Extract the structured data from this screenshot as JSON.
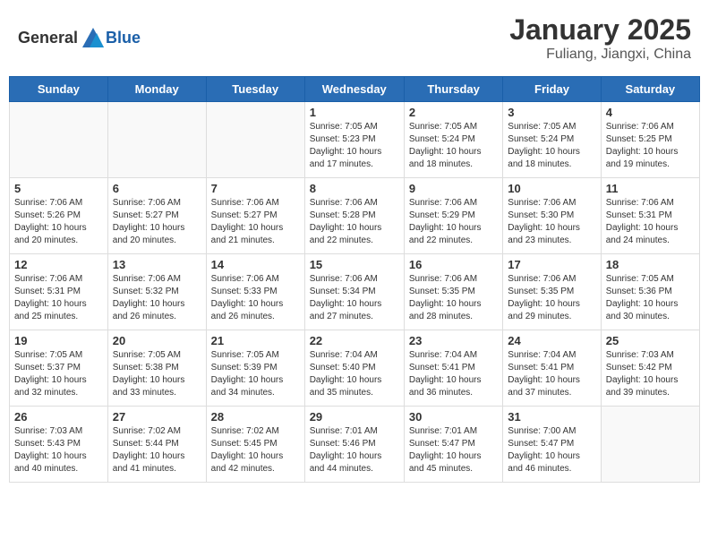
{
  "header": {
    "logo_general": "General",
    "logo_blue": "Blue",
    "month": "January 2025",
    "location": "Fuliang, Jiangxi, China"
  },
  "weekdays": [
    "Sunday",
    "Monday",
    "Tuesday",
    "Wednesday",
    "Thursday",
    "Friday",
    "Saturday"
  ],
  "weeks": [
    [
      {
        "day": "",
        "info": ""
      },
      {
        "day": "",
        "info": ""
      },
      {
        "day": "",
        "info": ""
      },
      {
        "day": "1",
        "info": "Sunrise: 7:05 AM\nSunset: 5:23 PM\nDaylight: 10 hours\nand 17 minutes."
      },
      {
        "day": "2",
        "info": "Sunrise: 7:05 AM\nSunset: 5:24 PM\nDaylight: 10 hours\nand 18 minutes."
      },
      {
        "day": "3",
        "info": "Sunrise: 7:05 AM\nSunset: 5:24 PM\nDaylight: 10 hours\nand 18 minutes."
      },
      {
        "day": "4",
        "info": "Sunrise: 7:06 AM\nSunset: 5:25 PM\nDaylight: 10 hours\nand 19 minutes."
      }
    ],
    [
      {
        "day": "5",
        "info": "Sunrise: 7:06 AM\nSunset: 5:26 PM\nDaylight: 10 hours\nand 20 minutes."
      },
      {
        "day": "6",
        "info": "Sunrise: 7:06 AM\nSunset: 5:27 PM\nDaylight: 10 hours\nand 20 minutes."
      },
      {
        "day": "7",
        "info": "Sunrise: 7:06 AM\nSunset: 5:27 PM\nDaylight: 10 hours\nand 21 minutes."
      },
      {
        "day": "8",
        "info": "Sunrise: 7:06 AM\nSunset: 5:28 PM\nDaylight: 10 hours\nand 22 minutes."
      },
      {
        "day": "9",
        "info": "Sunrise: 7:06 AM\nSunset: 5:29 PM\nDaylight: 10 hours\nand 22 minutes."
      },
      {
        "day": "10",
        "info": "Sunrise: 7:06 AM\nSunset: 5:30 PM\nDaylight: 10 hours\nand 23 minutes."
      },
      {
        "day": "11",
        "info": "Sunrise: 7:06 AM\nSunset: 5:31 PM\nDaylight: 10 hours\nand 24 minutes."
      }
    ],
    [
      {
        "day": "12",
        "info": "Sunrise: 7:06 AM\nSunset: 5:31 PM\nDaylight: 10 hours\nand 25 minutes."
      },
      {
        "day": "13",
        "info": "Sunrise: 7:06 AM\nSunset: 5:32 PM\nDaylight: 10 hours\nand 26 minutes."
      },
      {
        "day": "14",
        "info": "Sunrise: 7:06 AM\nSunset: 5:33 PM\nDaylight: 10 hours\nand 26 minutes."
      },
      {
        "day": "15",
        "info": "Sunrise: 7:06 AM\nSunset: 5:34 PM\nDaylight: 10 hours\nand 27 minutes."
      },
      {
        "day": "16",
        "info": "Sunrise: 7:06 AM\nSunset: 5:35 PM\nDaylight: 10 hours\nand 28 minutes."
      },
      {
        "day": "17",
        "info": "Sunrise: 7:06 AM\nSunset: 5:35 PM\nDaylight: 10 hours\nand 29 minutes."
      },
      {
        "day": "18",
        "info": "Sunrise: 7:05 AM\nSunset: 5:36 PM\nDaylight: 10 hours\nand 30 minutes."
      }
    ],
    [
      {
        "day": "19",
        "info": "Sunrise: 7:05 AM\nSunset: 5:37 PM\nDaylight: 10 hours\nand 32 minutes."
      },
      {
        "day": "20",
        "info": "Sunrise: 7:05 AM\nSunset: 5:38 PM\nDaylight: 10 hours\nand 33 minutes."
      },
      {
        "day": "21",
        "info": "Sunrise: 7:05 AM\nSunset: 5:39 PM\nDaylight: 10 hours\nand 34 minutes."
      },
      {
        "day": "22",
        "info": "Sunrise: 7:04 AM\nSunset: 5:40 PM\nDaylight: 10 hours\nand 35 minutes."
      },
      {
        "day": "23",
        "info": "Sunrise: 7:04 AM\nSunset: 5:41 PM\nDaylight: 10 hours\nand 36 minutes."
      },
      {
        "day": "24",
        "info": "Sunrise: 7:04 AM\nSunset: 5:41 PM\nDaylight: 10 hours\nand 37 minutes."
      },
      {
        "day": "25",
        "info": "Sunrise: 7:03 AM\nSunset: 5:42 PM\nDaylight: 10 hours\nand 39 minutes."
      }
    ],
    [
      {
        "day": "26",
        "info": "Sunrise: 7:03 AM\nSunset: 5:43 PM\nDaylight: 10 hours\nand 40 minutes."
      },
      {
        "day": "27",
        "info": "Sunrise: 7:02 AM\nSunset: 5:44 PM\nDaylight: 10 hours\nand 41 minutes."
      },
      {
        "day": "28",
        "info": "Sunrise: 7:02 AM\nSunset: 5:45 PM\nDaylight: 10 hours\nand 42 minutes."
      },
      {
        "day": "29",
        "info": "Sunrise: 7:01 AM\nSunset: 5:46 PM\nDaylight: 10 hours\nand 44 minutes."
      },
      {
        "day": "30",
        "info": "Sunrise: 7:01 AM\nSunset: 5:47 PM\nDaylight: 10 hours\nand 45 minutes."
      },
      {
        "day": "31",
        "info": "Sunrise: 7:00 AM\nSunset: 5:47 PM\nDaylight: 10 hours\nand 46 minutes."
      },
      {
        "day": "",
        "info": ""
      }
    ]
  ]
}
